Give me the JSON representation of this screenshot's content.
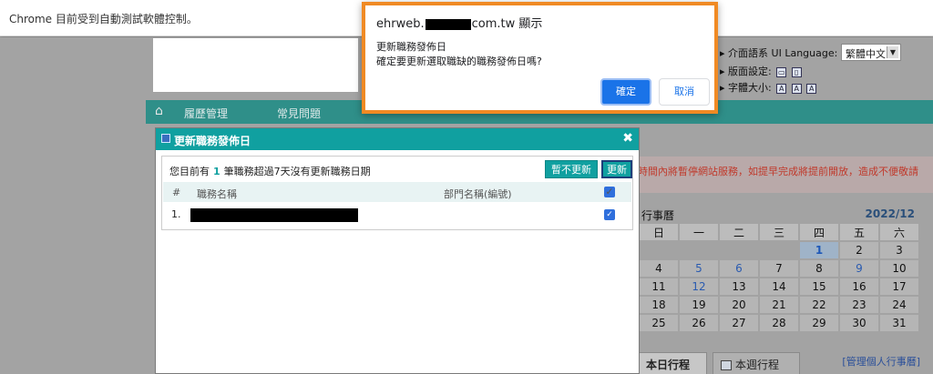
{
  "infobar": {
    "text": "Chrome 目前受到自動測試軟體控制。"
  },
  "lang": {
    "label": "介面語系 UI Language:",
    "selected": "繁體中文",
    "layout_label": "版面設定:",
    "font_label": "字體大小:",
    "font_sizes": [
      "A",
      "A",
      "A"
    ]
  },
  "nav": {
    "items": [
      "履歷管理",
      "常見問題"
    ]
  },
  "warning": {
    "text": "時間內將暫停網站服務，如提早完成將提前開放，造成不便敬請"
  },
  "calendar": {
    "title": "行事曆",
    "month": "2022/12",
    "weekdays": [
      "日",
      "一",
      "二",
      "三",
      "四",
      "五",
      "六"
    ],
    "rows": [
      [
        "",
        "",
        "",
        "",
        "1",
        "2",
        "3"
      ],
      [
        "4",
        "5",
        "6",
        "7",
        "8",
        "9",
        "10"
      ],
      [
        "11",
        "12",
        "13",
        "14",
        "15",
        "16",
        "17"
      ],
      [
        "18",
        "19",
        "20",
        "21",
        "22",
        "23",
        "24"
      ],
      [
        "25",
        "26",
        "27",
        "28",
        "29",
        "30",
        "31"
      ]
    ]
  },
  "tabs": {
    "today": "本日行程",
    "week": "本週行程",
    "manage": "[管理個人行事曆]"
  },
  "modal": {
    "title": "更新職務發佈日",
    "info_prefix": "您目前有",
    "info_count": "1",
    "info_suffix": "筆職務超過7天沒有更新職務日期",
    "skip_button": "暫不更新",
    "update_button": "更新",
    "columns": {
      "num": "#",
      "job": "職務名稱",
      "dept": "部門名稱(編號)"
    },
    "rows": [
      {
        "num": "1."
      }
    ]
  },
  "alert": {
    "origin_prefix": "ehrweb.",
    "origin_suffix": "com.tw 顯示",
    "line1": "更新職務發佈日",
    "line2": "確定要更新選取職缺的職務發佈日嗎?",
    "ok": "確定",
    "cancel": "取消"
  }
}
